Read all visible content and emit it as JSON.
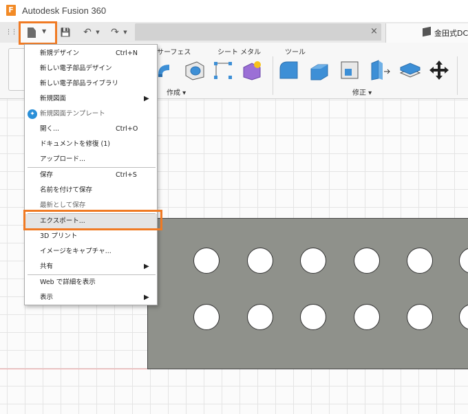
{
  "window": {
    "title": "Autodesk Fusion 360",
    "logo_letter": "F"
  },
  "toolbar": {
    "grid_glyph": "⋮⋮⋮",
    "dropdown_glyph": "▼",
    "save_glyph": "💾",
    "undo_glyph": "↶",
    "redo_glyph": "↷",
    "close_glyph": "×",
    "active_tab_label": "金田式DC"
  },
  "ribbon": {
    "tabs": [
      "サーフェス",
      "シート メタル",
      "ツール"
    ],
    "panels": [
      "作成 ▾",
      "修正 ▾"
    ]
  },
  "file_menu": {
    "submenu_glyph": "▶",
    "template_glyph": "✦",
    "items": [
      {
        "label": "新規デザイン",
        "shortcut": "Ctrl+N"
      },
      {
        "label": "新しい電子部品デザイン",
        "shortcut": ""
      },
      {
        "label": "新しい電子部品ライブラリ",
        "shortcut": ""
      },
      {
        "label": "新規図面",
        "shortcut": ""
      },
      {
        "label": "新規図面テンプレート",
        "shortcut": ""
      },
      {
        "label": "開く...",
        "shortcut": "Ctrl+O"
      },
      {
        "label": "ドキュメントを修復 (1)",
        "shortcut": ""
      },
      {
        "label": "アップロード...",
        "shortcut": ""
      },
      {
        "label": "保存",
        "shortcut": "Ctrl+S"
      },
      {
        "label": "名前を付けて保存",
        "shortcut": ""
      },
      {
        "label": "最新として保存",
        "shortcut": ""
      },
      {
        "label": "エクスポート...",
        "shortcut": ""
      },
      {
        "label": "3D プリント",
        "shortcut": ""
      },
      {
        "label": "イメージをキャプチャ...",
        "shortcut": ""
      },
      {
        "label": "共有",
        "shortcut": ""
      },
      {
        "label": "Web で詳細を表示",
        "shortcut": ""
      },
      {
        "label": "表示",
        "shortcut": ""
      }
    ]
  },
  "colors": {
    "highlight_outline": "#f07a23",
    "plate": "#8f918b",
    "accent_blue": "#2a8fd8"
  }
}
